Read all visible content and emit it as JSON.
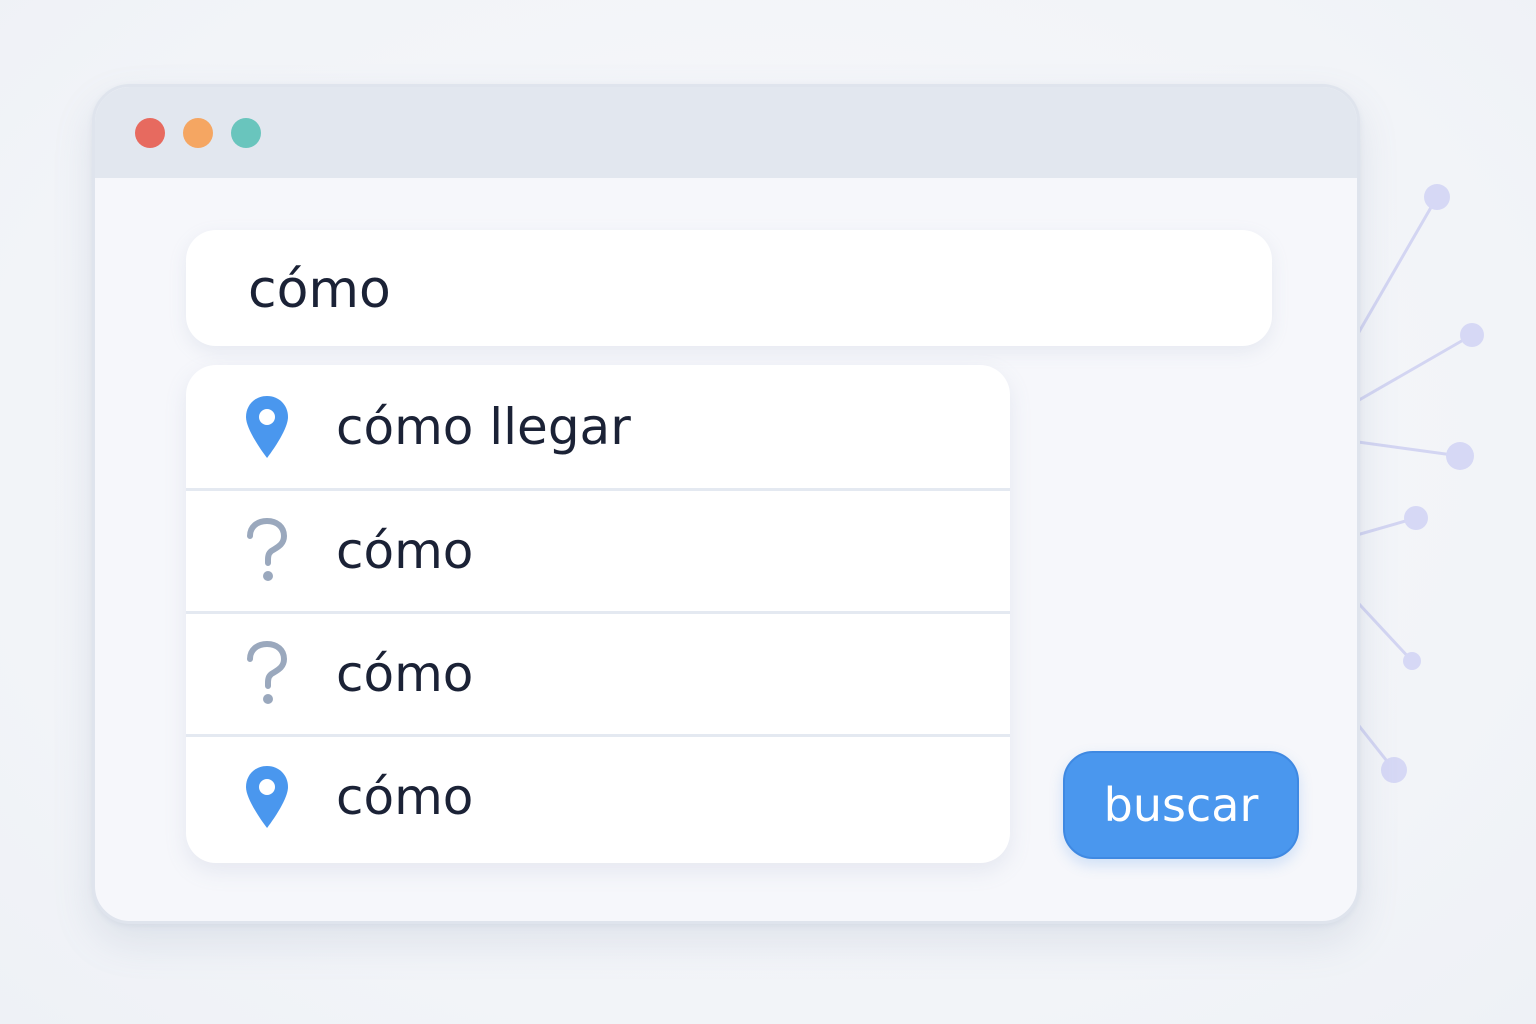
{
  "window": {
    "controls": [
      {
        "name": "close",
        "color": "#e76a5f"
      },
      {
        "name": "minimize",
        "color": "#f5a662"
      },
      {
        "name": "maximize",
        "color": "#69c5bd"
      }
    ]
  },
  "search": {
    "value": "cómo"
  },
  "suggestions": [
    {
      "icon": "location-pin-icon",
      "label": "cómo llegar"
    },
    {
      "icon": "question-mark-icon",
      "label": "cómo"
    },
    {
      "icon": "question-mark-icon",
      "label": "cómo"
    },
    {
      "icon": "location-pin-icon",
      "label": "cómo"
    }
  ],
  "search_button": {
    "label": "buscar"
  },
  "colors": {
    "accent": "#4a97ee",
    "pin": "#4a97ee",
    "question_mark": "#9aa8bd",
    "network": "#cfd2f3",
    "text": "#1b2236"
  }
}
